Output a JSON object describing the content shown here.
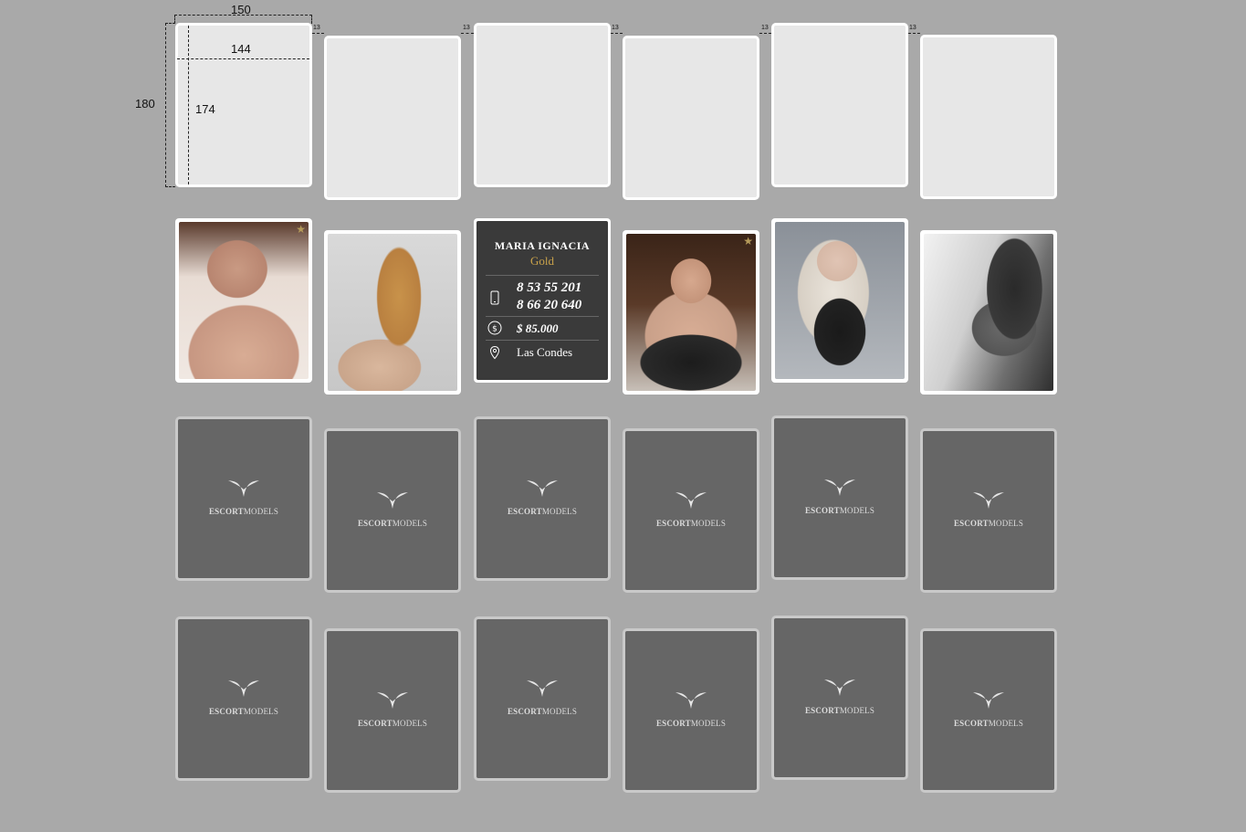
{
  "annotations": {
    "outer_width": "150",
    "inner_width": "144",
    "outer_height": "180",
    "inner_height": "174",
    "gap": "13"
  },
  "info_card": {
    "name": "MARIA IGNACIA",
    "tier": "Gold",
    "phone_1": "8 53 55 201",
    "phone_2": "8 66 20 640",
    "price": "$ 85.000",
    "location": "Las Condes"
  },
  "brand": {
    "bold": "ESCORT",
    "regular": "MODELS"
  },
  "colors": {
    "background": "#a9a9a9",
    "empty_card": "#e7e7e7",
    "logo_card": "#666666",
    "info_card": "#3a3a3a",
    "gold": "#c9a24a"
  },
  "grid": {
    "rows": [
      {
        "type": "empty",
        "cards": [
          "empty",
          "empty",
          "empty",
          "empty",
          "empty",
          "empty"
        ]
      },
      {
        "type": "photo",
        "cards": [
          "photo-topless-brunette",
          "photo-blonde-back",
          "info-card",
          "photo-brunette-lingerie",
          "photo-blonde-tattoo",
          "photo-bw-lingerie"
        ]
      },
      {
        "type": "logo",
        "cards": [
          "logo",
          "logo",
          "logo",
          "logo",
          "logo",
          "logo"
        ]
      },
      {
        "type": "logo",
        "cards": [
          "logo",
          "logo",
          "logo",
          "logo",
          "logo",
          "logo"
        ]
      }
    ],
    "featured_stars": [
      "photo-topless-brunette",
      "photo-brunette-lingerie"
    ]
  }
}
